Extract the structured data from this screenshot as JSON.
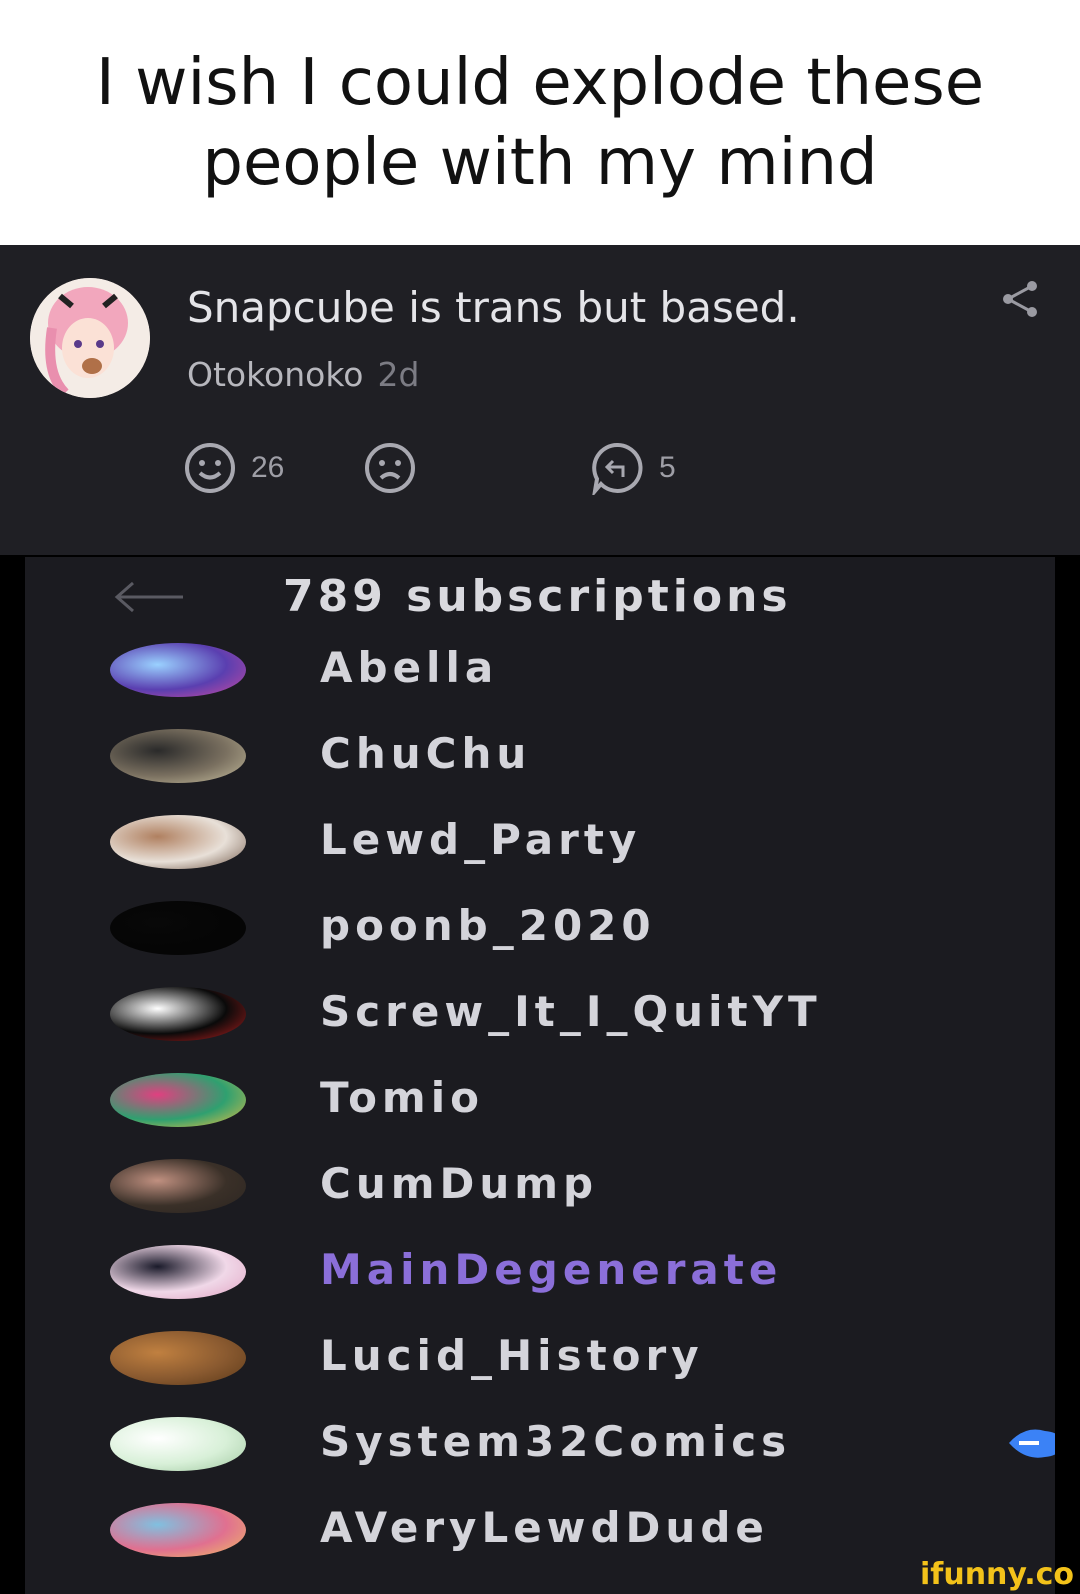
{
  "caption": "I wish I could explode these people with my mind",
  "post": {
    "title": "Snapcube is trans but based.",
    "username": "Otokonoko",
    "time": "2d",
    "smile_count": "26",
    "reply_count": "5"
  },
  "subscriptions": {
    "header": "789 subscriptions",
    "items": [
      {
        "name": "Abella",
        "colors": [
          "#5a3fb0",
          "#9ad1ff",
          "#d04aa0"
        ]
      },
      {
        "name": "ChuChu",
        "colors": [
          "#7a7060",
          "#2a2a2a",
          "#c8c0a0"
        ]
      },
      {
        "name": "Lewd_Party",
        "colors": [
          "#e8e0d8",
          "#b08060",
          "#6a5040"
        ]
      },
      {
        "name": "poonb_2020",
        "colors": [
          "#050505",
          "#080808",
          "#050505"
        ]
      },
      {
        "name": "Screw_It_I_QuitYT",
        "colors": [
          "#0a0a0a",
          "#ffffff",
          "#c02020"
        ]
      },
      {
        "name": "Tomio",
        "colors": [
          "#2fa070",
          "#e04080",
          "#f0c040"
        ]
      },
      {
        "name": "CumDump",
        "colors": [
          "#3a3028",
          "#c09080",
          "#2a2420"
        ]
      },
      {
        "name": "MainDegenerate",
        "colors": [
          "#f0d8e8",
          "#1a1a2a",
          "#e0a0c0"
        ]
      },
      {
        "name": "Lucid_History",
        "colors": [
          "#8a5a30",
          "#c08040",
          "#5a3818"
        ]
      },
      {
        "name": "System32Comics",
        "colors": [
          "#d8f0d8",
          "#ffffff",
          "#a0c8a0"
        ]
      },
      {
        "name": "AVeryLewdDude",
        "colors": [
          "#e07090",
          "#80c0e0",
          "#f0c060"
        ]
      }
    ]
  },
  "watermark": "ifunny.co"
}
